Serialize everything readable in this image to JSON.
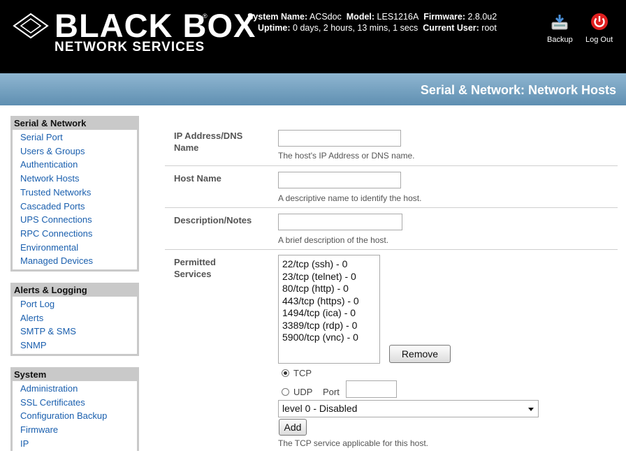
{
  "header": {
    "brand": "BLACK BOX",
    "brand_reg": "®",
    "brand_sub": "NETWORK SERVICES",
    "system_name_label": "System Name:",
    "system_name": "ACSdoc",
    "model_label": "Model:",
    "model": "LES1216A",
    "firmware_label": "Firmware:",
    "firmware": "2.8.0u2",
    "uptime_label": "Uptime:",
    "uptime": "0 days, 2 hours, 13 mins, 1 secs",
    "user_label": "Current User:",
    "user": "root",
    "backup_label": "Backup",
    "logout_label": "Log Out",
    "page_title": "Serial & Network: Network Hosts"
  },
  "sidebar": {
    "sections": [
      {
        "title": "Serial & Network",
        "items": [
          "Serial Port",
          "Users & Groups",
          "Authentication",
          "Network Hosts",
          "Trusted Networks",
          "Cascaded Ports",
          "UPS Connections",
          "RPC Connections",
          "Environmental",
          "Managed Devices"
        ]
      },
      {
        "title": "Alerts & Logging",
        "items": [
          "Port Log",
          "Alerts",
          "SMTP & SMS",
          "SNMP"
        ]
      },
      {
        "title": "System",
        "items": [
          "Administration",
          "SSL Certificates",
          "Configuration Backup",
          "Firmware",
          "IP"
        ]
      }
    ]
  },
  "form": {
    "ip": {
      "label": "IP Address/DNS Name",
      "value": "",
      "help": "The host's IP Address or DNS name."
    },
    "hostname": {
      "label": "Host Name",
      "value": "",
      "help": "A descriptive name to identify the host."
    },
    "description": {
      "label": "Description/Notes",
      "value": "",
      "help": "A brief description of the host."
    },
    "services": {
      "label": "Permitted Services",
      "items": [
        "22/tcp (ssh) - 0",
        "23/tcp (telnet) - 0",
        "80/tcp (http) - 0",
        "443/tcp (https) - 0",
        "1494/tcp (ica) - 0",
        "3389/tcp (rdp) - 0",
        "5900/tcp (vnc) - 0"
      ],
      "remove_label": "Remove",
      "tcp_label": "TCP",
      "udp_label": "UDP",
      "port_label": "Port",
      "port_value": "",
      "protocol_selected": "TCP",
      "level_selected": "level 0 - Disabled",
      "add_label": "Add",
      "footer_help": "The TCP service applicable for this host."
    }
  }
}
